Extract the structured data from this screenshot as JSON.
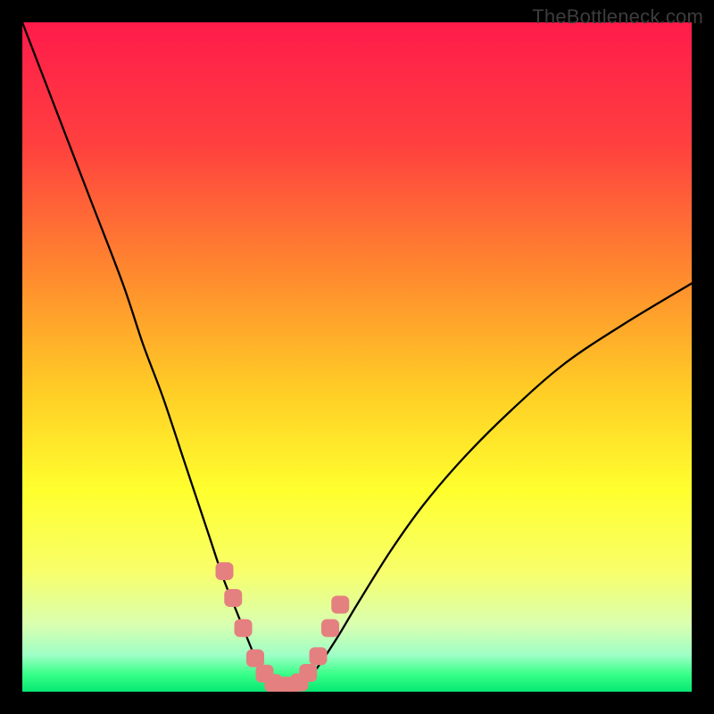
{
  "watermark": "TheBottleneck.com",
  "chart_data": {
    "type": "line",
    "title": "",
    "xlabel": "",
    "ylabel": "",
    "xlim": [
      0,
      100
    ],
    "ylim": [
      0,
      100
    ],
    "series": [
      {
        "name": "bottleneck-curve",
        "x": [
          0,
          5,
          10,
          15,
          18,
          21,
          24,
          26,
          28,
          30,
          32,
          34,
          35.5,
          37,
          38.5,
          40,
          42,
          44,
          47,
          50,
          55,
          60,
          66,
          73,
          81,
          90,
          100
        ],
        "y": [
          100,
          87,
          74,
          61,
          52,
          44,
          35,
          29,
          23,
          17,
          12,
          7,
          3.5,
          1.5,
          0.7,
          0.7,
          1.5,
          3.5,
          8,
          13,
          21,
          28,
          35,
          42,
          49,
          55,
          61
        ]
      }
    ],
    "markers": {
      "name": "highlight-points",
      "color": "#e58080",
      "x": [
        30.2,
        31.5,
        33,
        34.8,
        36.2,
        37.5,
        38.8,
        40.1,
        41.4,
        42.7,
        44.2,
        46.0,
        47.5
      ],
      "y": [
        18,
        14,
        9.5,
        5,
        2.7,
        1.3,
        0.9,
        0.9,
        1.4,
        2.8,
        5.3,
        9.5,
        13
      ]
    },
    "gradient_stops": [
      {
        "offset": 0.0,
        "color": "#ff1b4b"
      },
      {
        "offset": 0.18,
        "color": "#ff3f3f"
      },
      {
        "offset": 0.38,
        "color": "#ff8b2e"
      },
      {
        "offset": 0.55,
        "color": "#ffcd26"
      },
      {
        "offset": 0.7,
        "color": "#ffff2e"
      },
      {
        "offset": 0.82,
        "color": "#f8ff6a"
      },
      {
        "offset": 0.9,
        "color": "#d9ffb0"
      },
      {
        "offset": 0.945,
        "color": "#9fffc6"
      },
      {
        "offset": 0.975,
        "color": "#35ff86"
      },
      {
        "offset": 1.0,
        "color": "#06e873"
      }
    ]
  }
}
